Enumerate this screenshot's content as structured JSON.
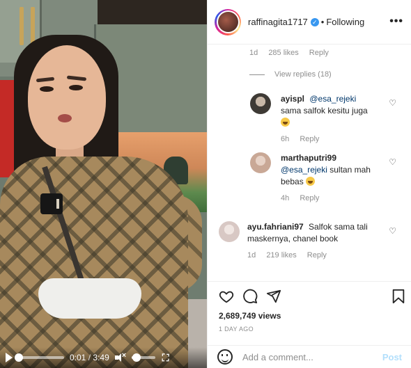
{
  "video": {
    "current_time": "0:01",
    "separator": "/",
    "duration": "3:49",
    "progress": 0.01,
    "volume": 0.2,
    "muted": true,
    "controls": {
      "play": "play-icon",
      "mute": "speaker-mute-icon",
      "fullscreen": "fullscreen-icon"
    }
  },
  "header": {
    "username": "raffinagita1717",
    "verified": true,
    "dot": "•",
    "follow_label": "Following",
    "more": "•••"
  },
  "comments": {
    "top_meta": {
      "time": "1d",
      "likes": "285 likes",
      "reply": "Reply"
    },
    "view_replies": "View replies (18)",
    "replies": [
      {
        "username": "ayispl",
        "mention": "@esa_rejeki",
        "text": "sama salfok kesitu juga",
        "emoji": true,
        "time": "6h",
        "reply": "Reply"
      },
      {
        "username": "marthaputri99",
        "mention": "@esa_rejeki",
        "text": "sultan mah bebas",
        "emoji": true,
        "time": "4h",
        "reply": "Reply"
      }
    ],
    "main": {
      "username": "ayu.fahriani97",
      "text": "Salfok sama tali maskernya, chanel book",
      "time": "1d",
      "likes": "219 likes",
      "reply": "Reply"
    }
  },
  "actions": {
    "icons": [
      "heart-icon",
      "comment-icon",
      "share-icon",
      "bookmark-icon"
    ],
    "views": "2,689,749 views",
    "posted": "1 DAY AGO"
  },
  "add_comment": {
    "placeholder": "Add a comment...",
    "post_label": "Post"
  },
  "colors": {
    "link": "#00376b",
    "muted_text": "#8e8e8e",
    "post_disabled": "#b2dffc",
    "verified": "#3897f0"
  }
}
